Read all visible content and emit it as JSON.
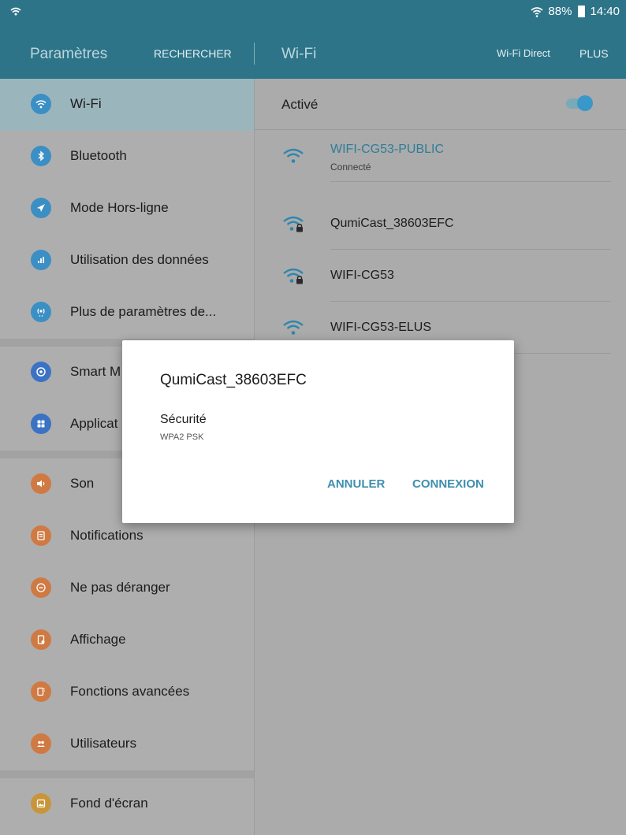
{
  "status_bar": {
    "battery": "88%",
    "time": "14:40"
  },
  "action_bar": {
    "title": "Paramètres",
    "search": "RECHERCHER",
    "section": "Wi-Fi",
    "wifi_direct": "Wi-Fi Direct",
    "more": "PLUS"
  },
  "menu": {
    "items": [
      {
        "label": "Wi-Fi",
        "icon": "wifi-icon",
        "color": "#3b8fc4"
      },
      {
        "label": "Bluetooth",
        "icon": "bluetooth-icon",
        "color": "#3b8fc4"
      },
      {
        "label": "Mode Hors-ligne",
        "icon": "airplane-icon",
        "color": "#3b8fc4"
      },
      {
        "label": "Utilisation des données",
        "icon": "data-usage-icon",
        "color": "#3b8fc4"
      },
      {
        "label": "Plus de paramètres de...",
        "icon": "connection-settings-icon",
        "color": "#3b8fc4"
      },
      {
        "label": "Smart M",
        "icon": "smart-manager-icon",
        "color": "#3b72c4"
      },
      {
        "label": "Applicat",
        "icon": "applications-icon",
        "color": "#3b72c4"
      },
      {
        "label": "Son",
        "icon": "sound-icon",
        "color": "#cf7a43"
      },
      {
        "label": "Notifications",
        "icon": "notifications-icon",
        "color": "#cf7a43"
      },
      {
        "label": "Ne pas déranger",
        "icon": "do-not-disturb-icon",
        "color": "#cf7a43"
      },
      {
        "label": "Affichage",
        "icon": "display-icon",
        "color": "#cf7a43"
      },
      {
        "label": "Fonctions avancées",
        "icon": "advanced-features-icon",
        "color": "#cf7a43"
      },
      {
        "label": "Utilisateurs",
        "icon": "users-icon",
        "color": "#cf7a43"
      },
      {
        "label": "Fond d'écran",
        "icon": "wallpaper-icon",
        "color": "#c9953a"
      }
    ]
  },
  "wifi": {
    "toggle_label": "Activé",
    "toggle_on": true,
    "networks": [
      {
        "name": "WIFI-CG53-PUBLIC",
        "status": "Connecté",
        "secured": false
      },
      {
        "name": "QumiCast_38603EFC",
        "status": "",
        "secured": true
      },
      {
        "name": "WIFI-CG53",
        "status": "",
        "secured": true
      },
      {
        "name": "WIFI-CG53-ELUS",
        "status": "",
        "secured": false
      }
    ]
  },
  "dialog": {
    "title": "QumiCast_38603EFC",
    "security_label": "Sécurité",
    "security_value": "WPA2 PSK",
    "cancel": "ANNULER",
    "connect": "CONNEXION"
  },
  "colors": {
    "accent": "#2d7488",
    "link": "#3d8fb0"
  }
}
